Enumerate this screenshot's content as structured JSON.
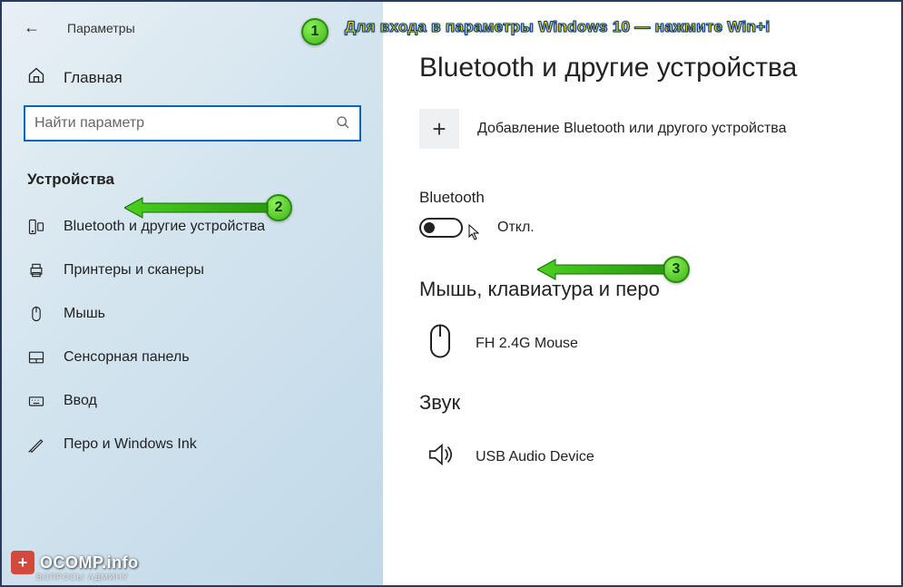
{
  "header": {
    "title": "Параметры"
  },
  "sidebar": {
    "home_label": "Главная",
    "search_placeholder": "Найти параметр",
    "category": "Устройства",
    "items": [
      {
        "label": "Bluetooth и другие устройства"
      },
      {
        "label": "Принтеры и сканеры"
      },
      {
        "label": "Мышь"
      },
      {
        "label": "Сенсорная панель"
      },
      {
        "label": "Ввод"
      },
      {
        "label": "Перо и Windows Ink"
      }
    ]
  },
  "main": {
    "title": "Bluetooth и другие устройства",
    "add_label": "Добавление Bluetooth или другого устройства",
    "bluetooth": {
      "label": "Bluetooth",
      "status": "Откл."
    },
    "input_section": {
      "heading": "Мышь, клавиатура и перо",
      "device": "FH 2.4G Mouse"
    },
    "sound_section": {
      "heading": "Звук",
      "device": "USB Audio Device"
    }
  },
  "annotations": {
    "tip1": "Для входа в параметры Windows 10 — нажмите Win+i",
    "badge1": "1",
    "badge2": "2",
    "badge3": "3"
  },
  "watermark": {
    "main": "OCOMP.info",
    "sub": "ВОПРОСЫ АДМИНУ"
  }
}
